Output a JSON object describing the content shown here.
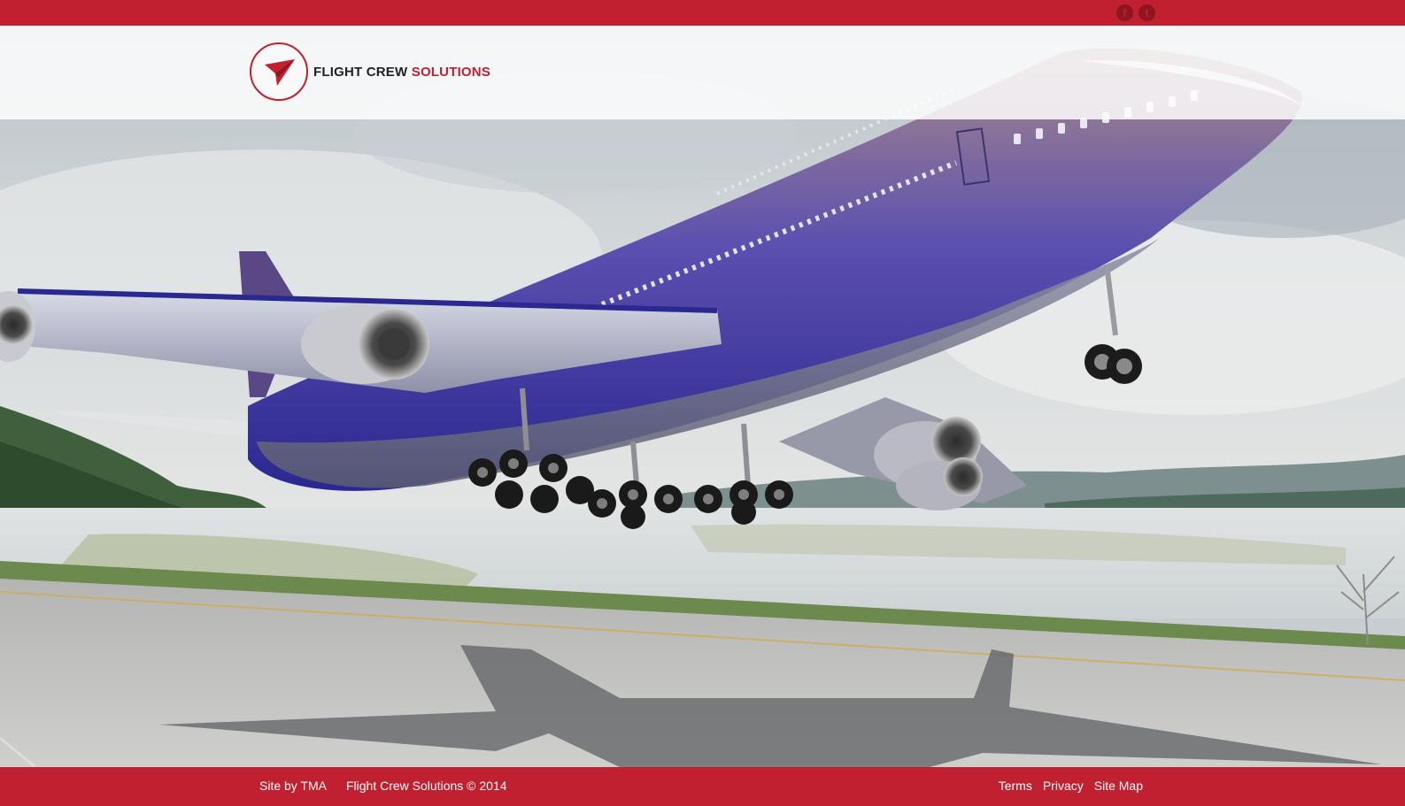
{
  "topbar": {
    "social": [
      {
        "icon": "facebook-icon",
        "glyph": "f"
      },
      {
        "icon": "twitter-icon",
        "glyph": "t"
      }
    ],
    "accent_color": "#c0202f"
  },
  "header": {
    "brand_word1": "FLIGHT CREW",
    "brand_word2": "SOLUTIONS",
    "logo_icon": "paper-plane-icon"
  },
  "hero": {
    "image": "jumbo-jet-takeoff-photo"
  },
  "footer": {
    "credit": "Site by TMA",
    "copyright": "Flight Crew Solutions © 2014",
    "links": [
      "Terms",
      "Privacy",
      "Site Map"
    ]
  }
}
